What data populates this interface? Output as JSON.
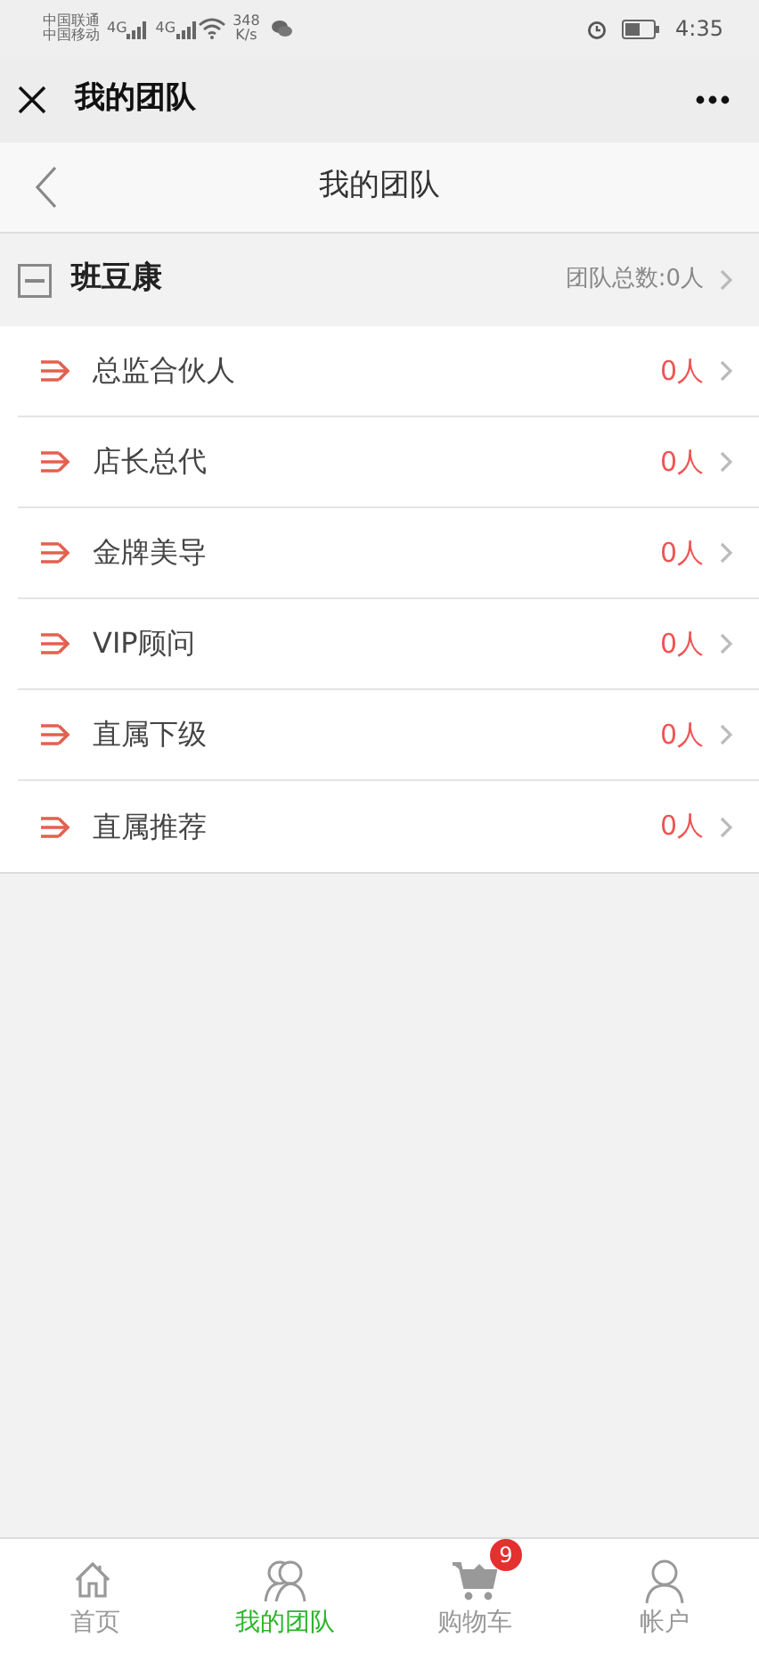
{
  "status_bar": {
    "carriers": [
      "中国联通",
      "中国移动"
    ],
    "network": [
      "4G",
      "4G"
    ],
    "speed": [
      "348",
      "K/s"
    ],
    "time": "4:35"
  },
  "app_bar": {
    "title": "我的团队"
  },
  "header": {
    "title": "我的团队"
  },
  "group": {
    "name": "班豆康",
    "expanded": true,
    "total": "团队总数:0人",
    "items": [
      {
        "label": "总监合伙人",
        "count": "0人"
      },
      {
        "label": "店长总代",
        "count": "0人"
      },
      {
        "label": "金牌美导",
        "count": "0人"
      },
      {
        "label": "VIP顾问",
        "count": "0人"
      },
      {
        "label": "直属下级",
        "count": "0人"
      },
      {
        "label": "直属推荐",
        "count": "0人"
      }
    ]
  },
  "tab_bar": [
    {
      "label": "首页",
      "kind": "home",
      "selected": false
    },
    {
      "label": "我的团队",
      "kind": "team",
      "selected": true
    },
    {
      "label": "购物车",
      "kind": "cart",
      "selected": false,
      "badge": "9"
    },
    {
      "label": "帐户",
      "kind": "account",
      "selected": false
    }
  ]
}
